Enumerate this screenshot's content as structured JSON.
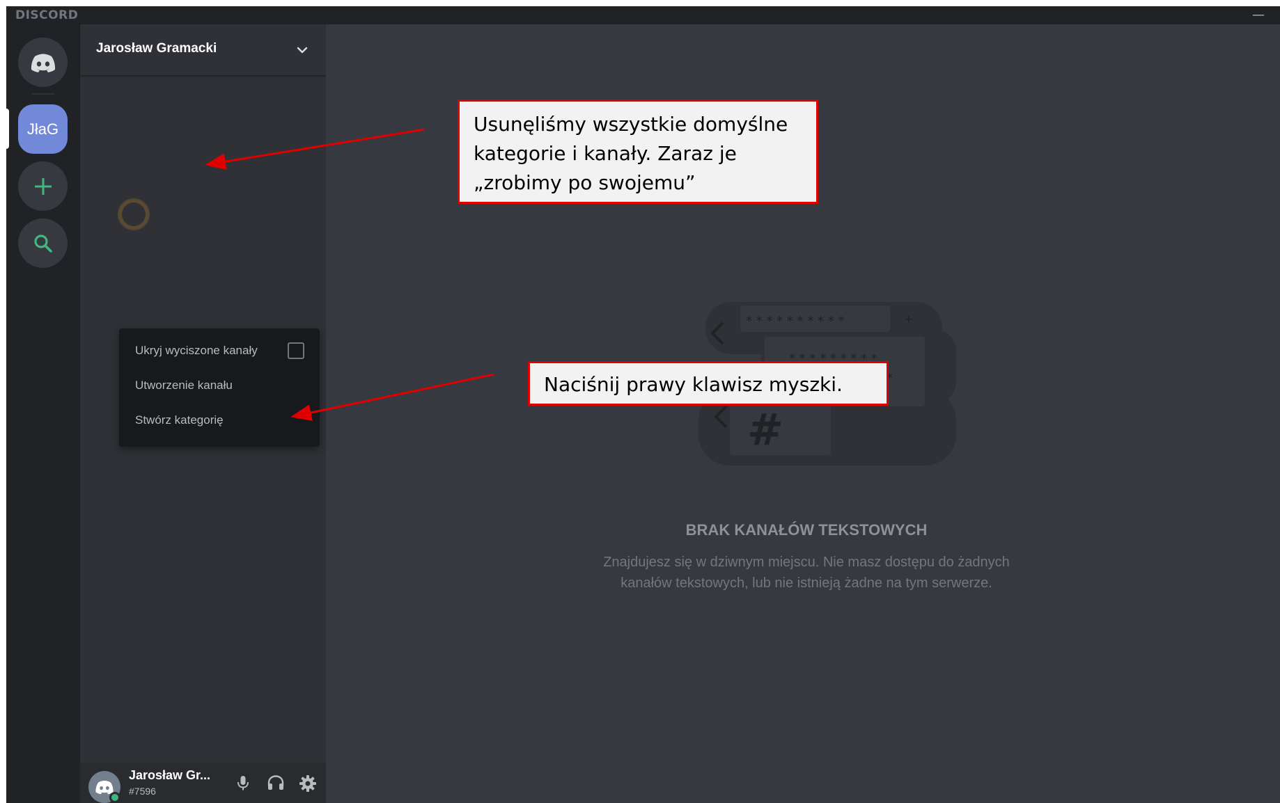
{
  "app": {
    "wordmark": "DISCORD",
    "minimize_glyph": "—"
  },
  "rail": {
    "home_icon": "discord-logo-icon",
    "server_abbrev": "JłaG",
    "add_icon": "plus-icon",
    "search_icon": "magnifier-icon"
  },
  "sidebar": {
    "server_name": "Jarosław Gramacki",
    "context_menu": {
      "items": [
        "Ukryj wyciszone kanały",
        "Utworzenie kanału",
        "Stwórz kategorię"
      ]
    },
    "user": {
      "name": "Jarosław Gr...",
      "tag": "#7596"
    }
  },
  "main": {
    "empty_title": "BRAK KANAŁÓW TEKSTOWYCH",
    "empty_desc_line1": "Znajdujesz się w dziwnym miejscu. Nie masz dostępu do żadnych",
    "empty_desc_line2": "kanałów tekstowych, lub nie istnieją żadne na tym serwerze."
  },
  "annotations": {
    "callout_1_line1": "Usunęliśmy wszystkie domyślne",
    "callout_1_line2": "kategorie i kanały. Zaraz je",
    "callout_1_line3": "„zrobimy po swojemu”",
    "callout_2": "Naciśnij prawy klawisz myszki."
  },
  "colors": {
    "accent": "#7289da",
    "online": "#43b581",
    "annotation_border": "#e00000",
    "annotation_arrow": "#e00000"
  }
}
